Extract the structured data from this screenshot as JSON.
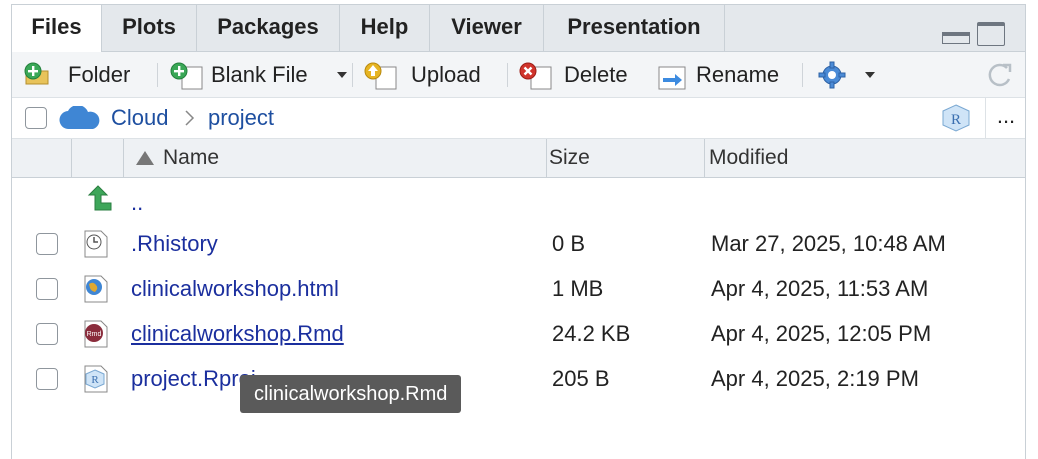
{
  "tabs": [
    {
      "label": "Files",
      "active": true
    },
    {
      "label": "Plots"
    },
    {
      "label": "Packages"
    },
    {
      "label": "Help"
    },
    {
      "label": "Viewer"
    },
    {
      "label": "Presentation"
    }
  ],
  "toolbar": {
    "folder": "Folder",
    "blank_file": "Blank File",
    "upload": "Upload",
    "delete": "Delete",
    "rename": "Rename"
  },
  "breadcrumb": {
    "root": "Cloud",
    "separator": ">",
    "current": "project",
    "more": "..."
  },
  "columns": {
    "name": "Name",
    "size": "Size",
    "modified": "Modified"
  },
  "sort": {
    "column": "Name",
    "direction": "ascending"
  },
  "files": [
    {
      "name": "..",
      "size": "",
      "modified": "",
      "icon": "parent-folder-icon"
    },
    {
      "name": ".Rhistory",
      "size": "0 B",
      "modified": "Mar 27, 2025, 10:48 AM",
      "icon": "history-file-icon"
    },
    {
      "name": "clinicalworkshop.html",
      "size": "1 MB",
      "modified": "Apr 4, 2025, 11:53 AM",
      "icon": "html-file-icon"
    },
    {
      "name": "clinicalworkshop.Rmd",
      "size": "24.2 KB",
      "modified": "Apr 4, 2025, 12:05 PM",
      "icon": "rmd-file-icon"
    },
    {
      "name": "project.Rproj",
      "size": "205 B",
      "modified": "Apr 4, 2025, 2:19 PM",
      "icon": "rproj-file-icon"
    }
  ],
  "tooltip": "clinicalworkshop.Rmd",
  "colors": {
    "link": "#1b2f9e",
    "tab_bg": "#e4e8ec",
    "toolbar_bg": "#f3f5f7"
  }
}
